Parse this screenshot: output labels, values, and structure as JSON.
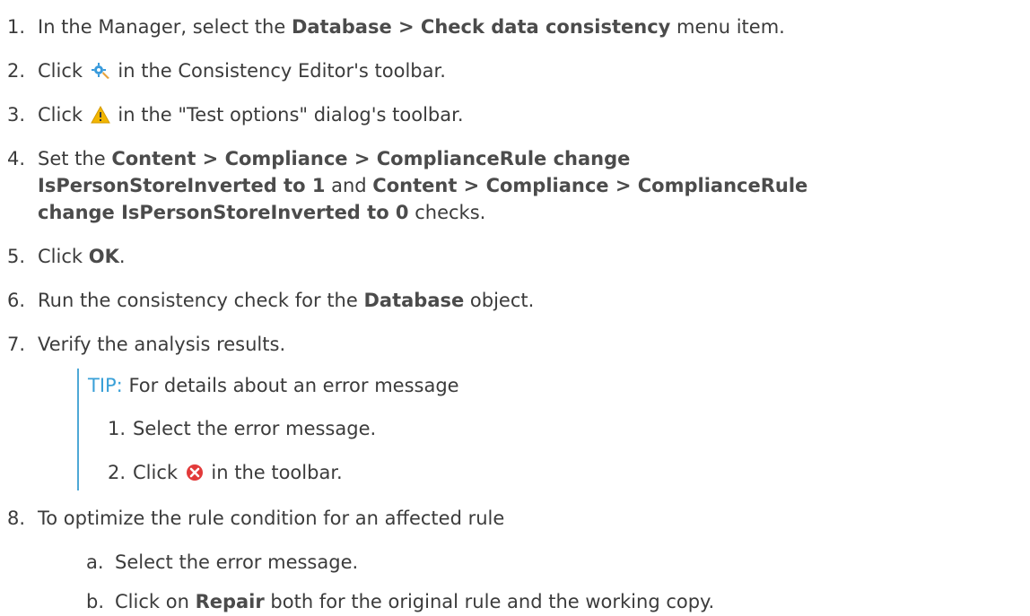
{
  "steps": [
    {
      "num": "1.",
      "pre": "In the Manager, select the ",
      "bold": "Database > Check data consistency",
      "post": " menu item."
    },
    {
      "num": "2.",
      "pre": "Click ",
      "icon": "consistency-settings-icon",
      "post": " in the Consistency Editor's toolbar."
    },
    {
      "num": "3.",
      "pre": "Click ",
      "icon": "warning-icon",
      "post": " in the \"Test options\" dialog's toolbar."
    },
    {
      "num": "4.",
      "pre": "Set the ",
      "bold1": "Content > Compliance > ComplianceRule change",
      "bold2": "IsPersonStoreInverted to 1",
      "mid": " and ",
      "bold3": "Content > Compliance > ComplianceRule",
      "bold4": "change IsPersonStoreInverted to 0",
      "post": " checks."
    },
    {
      "num": "5.",
      "pre": "Click ",
      "bold": "OK",
      "post": "."
    },
    {
      "num": "6.",
      "pre": "Run the consistency check for the ",
      "bold": "Database",
      "post": " object."
    },
    {
      "num": "7.",
      "pre": "Verify the analysis results."
    },
    {
      "num": "8.",
      "pre": "To optimize the rule condition for an affected rule"
    }
  ],
  "tip": {
    "label": "TIP:",
    "text": " For details about an error message",
    "items": [
      {
        "num": "1.",
        "pre": "Select the error message."
      },
      {
        "num": "2.",
        "pre": "Click ",
        "icon": "error-icon",
        "post": " in the toolbar."
      }
    ]
  },
  "substeps": [
    {
      "num": "a.",
      "pre": "Select the error message."
    },
    {
      "num": "b.",
      "pre": "Click on ",
      "bold": "Repair",
      "post": " both for the original rule and the working copy."
    }
  ],
  "colors": {
    "text": "#3b3b3b",
    "tip_accent": "#3aa0d8",
    "warning": "#f2b600",
    "error": "#e23a3a",
    "settings": "#3a9bdc"
  }
}
